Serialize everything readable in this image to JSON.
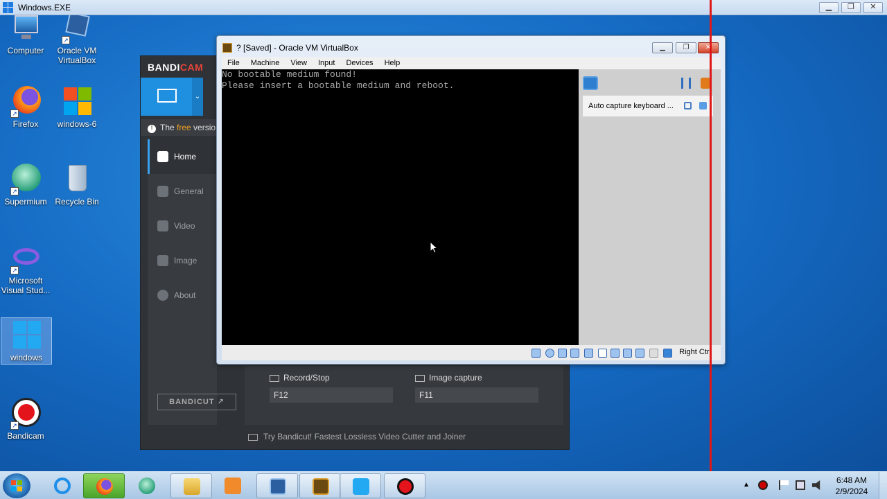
{
  "host_window": {
    "title": "Windows.EXE",
    "minimize": "▁",
    "restore": "❐",
    "close": "✕"
  },
  "desktop_icons": [
    {
      "label": "Computer",
      "icon": "computer-icon"
    },
    {
      "label": "Oracle VM VirtualBox",
      "icon": "virtualbox-icon"
    },
    {
      "label": "Firefox",
      "icon": "firefox-icon"
    },
    {
      "label": "windows-6",
      "icon": "windows-logo-icon"
    },
    {
      "label": "Supermium",
      "icon": "supermium-icon"
    },
    {
      "label": "Recycle Bin",
      "icon": "recycle-bin-icon"
    },
    {
      "label": "Microsoft Visual Stud...",
      "icon": "visual-studio-icon"
    },
    {
      "label": "windows",
      "icon": "windows-logo-icon"
    },
    {
      "label": "Bandicam",
      "icon": "bandicam-icon"
    }
  ],
  "bandicam": {
    "brand_a": "BANDI",
    "brand_b": "CAM",
    "notice_prefix": "The ",
    "notice_free": "free",
    "notice_suffix": " versio",
    "nav": [
      "Home",
      "General",
      "Video",
      "Image",
      "About"
    ],
    "bandicut_label": "BANDICUT ↗",
    "hotkeys": {
      "record_label": "Record/Stop",
      "record_value": "F12",
      "capture_label": "Image capture",
      "capture_value": "F11"
    },
    "footer": "Try Bandicut! Fastest Lossless Video Cutter and Joiner"
  },
  "vbox": {
    "title": "? [Saved] - Oracle VM VirtualBox",
    "menu": [
      "File",
      "Machine",
      "View",
      "Input",
      "Devices",
      "Help"
    ],
    "screen_lines": [
      "No bootable medium found!",
      "Please insert a bootable medium and reboot."
    ],
    "notification": "Auto capture keyboard ...",
    "host_key": "Right Ctrl",
    "minimize": "▁",
    "restore": "❐",
    "close": "✕"
  },
  "taskbar": {
    "apps": [
      "internet-explorer-icon",
      "firefox-icon",
      "supermium-icon",
      "file-explorer-icon",
      "media-player-icon",
      "virtualbox-icon",
      "virtualbox-vm-icon",
      "windows-logo-icon",
      "bandicam-icon"
    ],
    "time": "6:48 AM",
    "date": "2/9/2024"
  },
  "colors": {
    "accent_blue": "#1f8fe0",
    "bandicam_red": "#e8443a",
    "guide_red": "#e01818"
  }
}
